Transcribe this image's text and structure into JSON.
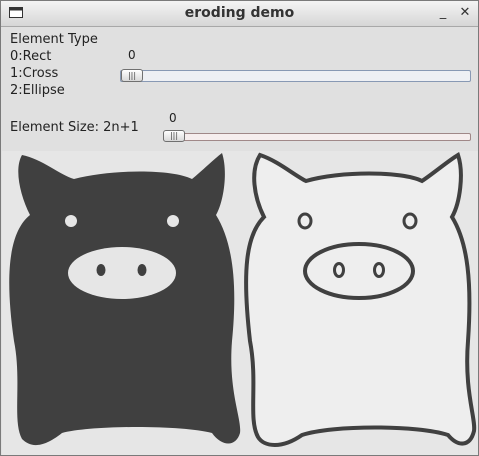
{
  "window": {
    "title": "eroding demo",
    "minimize_label": "_",
    "close_label": "✕"
  },
  "trackbars": {
    "element_type": {
      "label_lines": [
        "Element Type",
        "0:Rect",
        "1:Cross",
        "2:Ellipse"
      ],
      "value": "0"
    },
    "element_size": {
      "label": "Element Size: 2n+1",
      "value": "0"
    }
  },
  "image": {
    "left_pig_fill": "#404040",
    "right_pig_fill": "#eeeeee",
    "background": "#e6e6e6"
  }
}
